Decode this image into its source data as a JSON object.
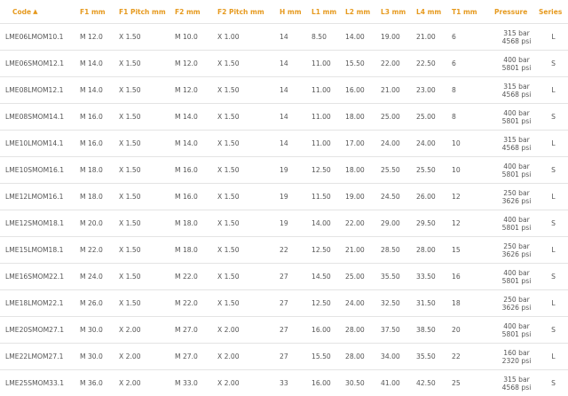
{
  "table": {
    "headers": [
      "Code",
      "F1 mm",
      "F1 Pitch mm",
      "F2 mm",
      "F2 Pitch mm",
      "H mm",
      "L1 mm",
      "L2 mm",
      "L3 mm",
      "L4 mm",
      "T1 mm",
      "Pressure",
      "Series"
    ],
    "sort_icon": "chevron-up-icon",
    "rows": [
      {
        "code": "LME06LMOM10.1",
        "f1": "M 12.0",
        "f1p": "X 1.50",
        "f2": "M 10.0",
        "f2p": "X 1.00",
        "h": "14",
        "l1": "8.50",
        "l2": "14.00",
        "l3": "19.00",
        "l4": "21.00",
        "t1": "6",
        "p_bar": "315 bar",
        "p_psi": "4568 psi",
        "series": "L"
      },
      {
        "code": "LME06SMOM12.1",
        "f1": "M 14.0",
        "f1p": "X 1.50",
        "f2": "M 12.0",
        "f2p": "X 1.50",
        "h": "14",
        "l1": "11.00",
        "l2": "15.50",
        "l3": "22.00",
        "l4": "22.50",
        "t1": "6",
        "p_bar": "400 bar",
        "p_psi": "5801 psi",
        "series": "S"
      },
      {
        "code": "LME08LMOM12.1",
        "f1": "M 14.0",
        "f1p": "X 1.50",
        "f2": "M 12.0",
        "f2p": "X 1.50",
        "h": "14",
        "l1": "11.00",
        "l2": "16.00",
        "l3": "21.00",
        "l4": "23.00",
        "t1": "8",
        "p_bar": "315 bar",
        "p_psi": "4568 psi",
        "series": "L"
      },
      {
        "code": "LME08SMOM14.1",
        "f1": "M 16.0",
        "f1p": "X 1.50",
        "f2": "M 14.0",
        "f2p": "X 1.50",
        "h": "14",
        "l1": "11.00",
        "l2": "18.00",
        "l3": "25.00",
        "l4": "25.00",
        "t1": "8",
        "p_bar": "400 bar",
        "p_psi": "5801 psi",
        "series": "S"
      },
      {
        "code": "LME10LMOM14.1",
        "f1": "M 16.0",
        "f1p": "X 1.50",
        "f2": "M 14.0",
        "f2p": "X 1.50",
        "h": "14",
        "l1": "11.00",
        "l2": "17.00",
        "l3": "24.00",
        "l4": "24.00",
        "t1": "10",
        "p_bar": "315 bar",
        "p_psi": "4568 psi",
        "series": "L"
      },
      {
        "code": "LME10SMOM16.1",
        "f1": "M 18.0",
        "f1p": "X 1.50",
        "f2": "M 16.0",
        "f2p": "X 1.50",
        "h": "19",
        "l1": "12.50",
        "l2": "18.00",
        "l3": "25.50",
        "l4": "25.50",
        "t1": "10",
        "p_bar": "400 bar",
        "p_psi": "5801 psi",
        "series": "S"
      },
      {
        "code": "LME12LMOM16.1",
        "f1": "M 18.0",
        "f1p": "X 1.50",
        "f2": "M 16.0",
        "f2p": "X 1.50",
        "h": "19",
        "l1": "11.50",
        "l2": "19.00",
        "l3": "24.50",
        "l4": "26.00",
        "t1": "12",
        "p_bar": "250 bar",
        "p_psi": "3626 psi",
        "series": "L"
      },
      {
        "code": "LME12SMOM18.1",
        "f1": "M 20.0",
        "f1p": "X 1.50",
        "f2": "M 18.0",
        "f2p": "X 1.50",
        "h": "19",
        "l1": "14.00",
        "l2": "22.00",
        "l3": "29.00",
        "l4": "29.50",
        "t1": "12",
        "p_bar": "400 bar",
        "p_psi": "5801 psi",
        "series": "S"
      },
      {
        "code": "LME15LMOM18.1",
        "f1": "M 22.0",
        "f1p": "X 1.50",
        "f2": "M 18.0",
        "f2p": "X 1.50",
        "h": "22",
        "l1": "12.50",
        "l2": "21.00",
        "l3": "28.50",
        "l4": "28.00",
        "t1": "15",
        "p_bar": "250 bar",
        "p_psi": "3626 psi",
        "series": "L"
      },
      {
        "code": "LME16SMOM22.1",
        "f1": "M 24.0",
        "f1p": "X 1.50",
        "f2": "M 22.0",
        "f2p": "X 1.50",
        "h": "27",
        "l1": "14.50",
        "l2": "25.00",
        "l3": "35.50",
        "l4": "33.50",
        "t1": "16",
        "p_bar": "400 bar",
        "p_psi": "5801 psi",
        "series": "S"
      },
      {
        "code": "LME18LMOM22.1",
        "f1": "M 26.0",
        "f1p": "X 1.50",
        "f2": "M 22.0",
        "f2p": "X 1.50",
        "h": "27",
        "l1": "12.50",
        "l2": "24.00",
        "l3": "32.50",
        "l4": "31.50",
        "t1": "18",
        "p_bar": "250 bar",
        "p_psi": "3626 psi",
        "series": "L"
      },
      {
        "code": "LME20SMOM27.1",
        "f1": "M 30.0",
        "f1p": "X 2.00",
        "f2": "M 27.0",
        "f2p": "X 2.00",
        "h": "27",
        "l1": "16.00",
        "l2": "28.00",
        "l3": "37.50",
        "l4": "38.50",
        "t1": "20",
        "p_bar": "400 bar",
        "p_psi": "5801 psi",
        "series": "S"
      },
      {
        "code": "LME22LMOM27.1",
        "f1": "M 30.0",
        "f1p": "X 2.00",
        "f2": "M 27.0",
        "f2p": "X 2.00",
        "h": "27",
        "l1": "15.50",
        "l2": "28.00",
        "l3": "34.00",
        "l4": "35.50",
        "t1": "22",
        "p_bar": "160 bar",
        "p_psi": "2320 psi",
        "series": "L"
      },
      {
        "code": "LME25SMOM33.1",
        "f1": "M 36.0",
        "f1p": "X 2.00",
        "f2": "M 33.0",
        "f2p": "X 2.00",
        "h": "33",
        "l1": "16.00",
        "l2": "30.50",
        "l3": "41.00",
        "l4": "42.50",
        "t1": "25",
        "p_bar": "315 bar",
        "p_psi": "4568 psi",
        "series": "S"
      }
    ]
  }
}
